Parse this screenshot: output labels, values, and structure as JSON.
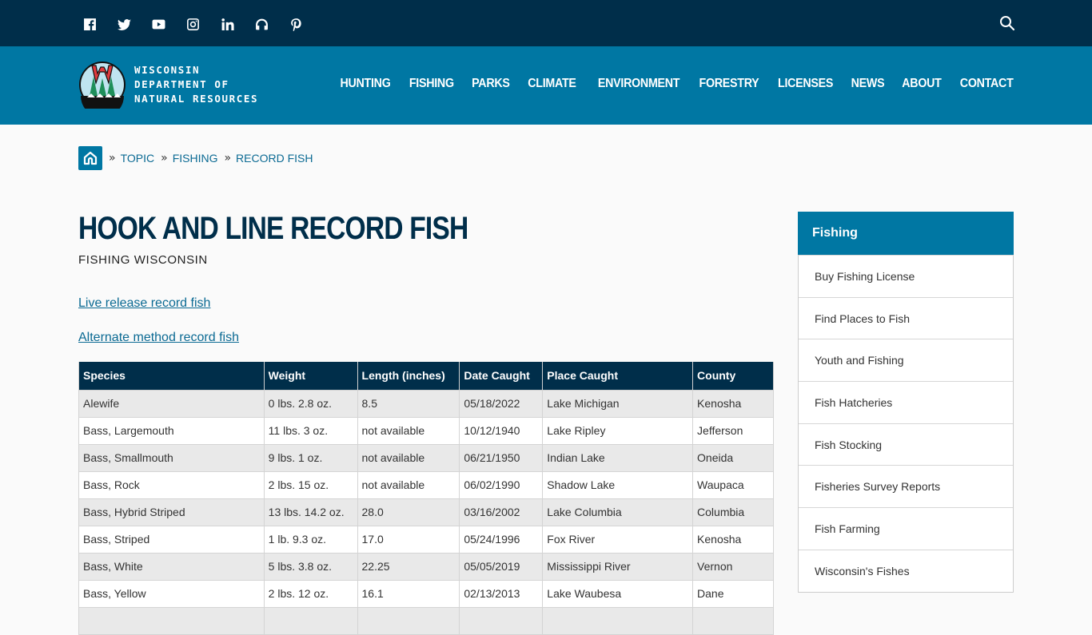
{
  "topbar": {
    "social": [
      {
        "icon": "facebook-icon"
      },
      {
        "icon": "twitter-icon"
      },
      {
        "icon": "youtube-icon"
      },
      {
        "icon": "instagram-icon"
      },
      {
        "icon": "linkedin-icon"
      },
      {
        "icon": "podcast-icon"
      },
      {
        "icon": "pinterest-icon"
      }
    ],
    "search_icon": "search-icon"
  },
  "header": {
    "logo_lines": [
      "WISCONSIN",
      "DEPARTMENT OF",
      "NATURAL RESOURCES"
    ],
    "nav": [
      "HUNTING",
      "FISHING",
      "PARKS",
      "CLIMATE",
      "ENVIRONMENT",
      "FORESTRY",
      "LICENSES",
      "NEWS",
      "ABOUT",
      "CONTACT"
    ]
  },
  "breadcrumb": {
    "separator": "»",
    "items": [
      "TOPIC",
      "FISHING",
      "RECORD FISH"
    ]
  },
  "page": {
    "title": "HOOK AND LINE RECORD FISH",
    "subtitle": "FISHING WISCONSIN",
    "links": [
      "Live release record fish",
      "Alternate method record fish"
    ]
  },
  "table": {
    "headers": [
      "Species",
      "Weight",
      "Length (inches)",
      "Date Caught",
      "Place Caught",
      "County"
    ],
    "rows": [
      [
        "Alewife",
        "0 lbs. 2.8 oz.",
        "8.5",
        "05/18/2022",
        "Lake Michigan",
        "Kenosha"
      ],
      [
        "Bass, Largemouth",
        "11 lbs. 3 oz.",
        "not available",
        "10/12/1940",
        "Lake Ripley",
        "Jefferson"
      ],
      [
        "Bass, Smallmouth",
        "9 lbs. 1 oz.",
        "not available",
        "06/21/1950",
        "Indian Lake",
        "Oneida"
      ],
      [
        "Bass, Rock",
        "2 lbs. 15 oz.",
        "not available",
        "06/02/1990",
        "Shadow Lake",
        "Waupaca"
      ],
      [
        "Bass, Hybrid Striped",
        "13 lbs. 14.2 oz.",
        "28.0",
        "03/16/2002",
        "Lake Columbia",
        "Columbia"
      ],
      [
        "Bass, Striped",
        "1 lb. 9.3 oz.",
        "17.0",
        "05/24/1996",
        "Fox River",
        "Kenosha"
      ],
      [
        "Bass, White",
        "5 lbs. 3.8 oz.",
        "22.25",
        "05/05/2019",
        "Mississippi River",
        "Vernon"
      ],
      [
        "Bass, Yellow",
        "2 lbs. 12 oz.",
        "16.1",
        "02/13/2013",
        "Lake Waubesa",
        "Dane"
      ],
      [
        "",
        "",
        "",
        "",
        "",
        ""
      ]
    ]
  },
  "sidebar": {
    "title": "Fishing",
    "items": [
      "Buy Fishing License",
      "Find Places to Fish",
      "Youth and Fishing",
      "Fish Hatcheries",
      "Fish Stocking",
      "Fisheries Survey Reports",
      "Fish Farming",
      "Wisconsin's Fishes"
    ]
  },
  "colors": {
    "topbar": "#002e4a",
    "brand_blue": "#0077a3",
    "link": "#0b6a93",
    "title": "#002e4a"
  }
}
